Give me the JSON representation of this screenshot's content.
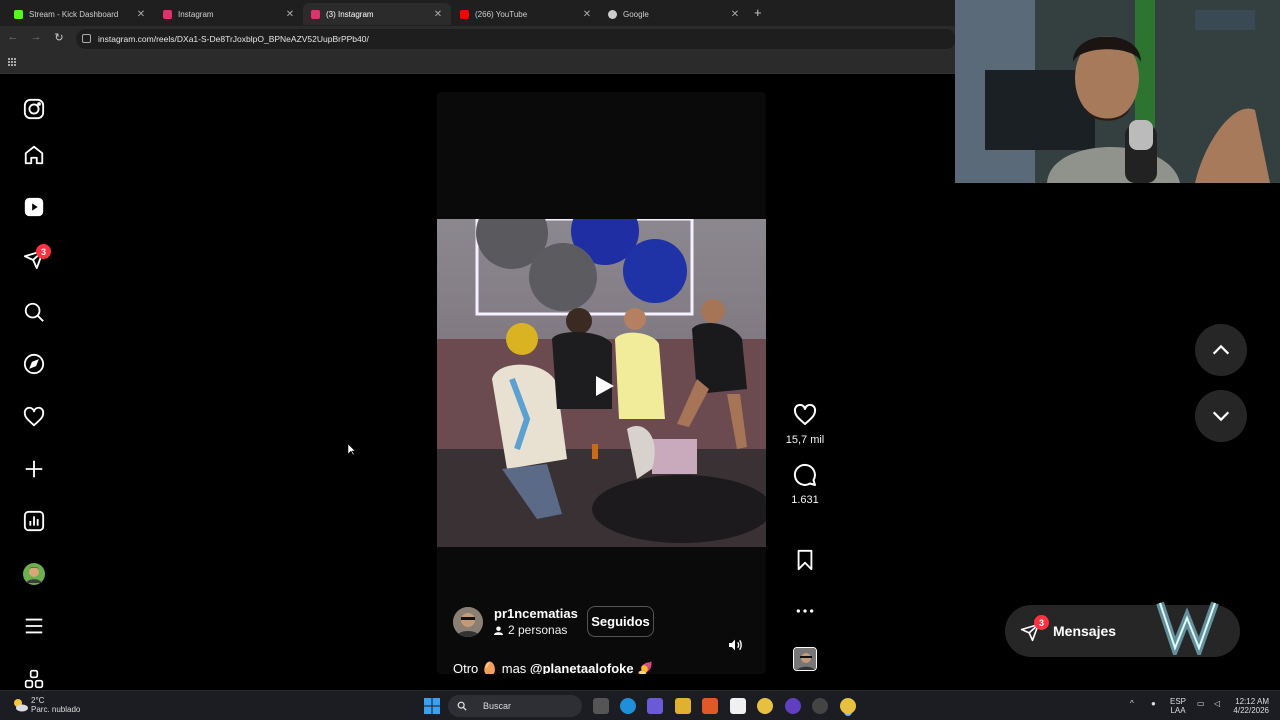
{
  "browser": {
    "tabs": [
      {
        "label": "Stream - Kick Dashboard",
        "color": "#53fc18",
        "active": false
      },
      {
        "label": "Instagram",
        "color": "#e1306c",
        "active": false
      },
      {
        "label": "(3) Instagram",
        "color": "#e1306c",
        "active": true
      },
      {
        "label": "(266) YouTube",
        "color": "#ff0000",
        "active": false
      },
      {
        "label": "Google",
        "color": "#cccccc",
        "active": false
      }
    ],
    "new_tab": "+",
    "url": "instagram.com/reels/DXa1-S-De8TrJoxblpO_BPNeAZV52UupBrPPb40/"
  },
  "sidebar": {
    "items": [
      {
        "icon": "instagram-icon"
      },
      {
        "icon": "home-icon"
      },
      {
        "icon": "reels-icon"
      },
      {
        "icon": "messages-icon",
        "badge": "3"
      },
      {
        "icon": "search-icon"
      },
      {
        "icon": "explore-icon"
      },
      {
        "icon": "notifications-icon"
      },
      {
        "icon": "create-icon"
      },
      {
        "icon": "dashboard-icon"
      },
      {
        "icon": "profile-avatar"
      },
      {
        "icon": "menu-icon"
      },
      {
        "icon": "also-from-meta-icon"
      }
    ]
  },
  "reel": {
    "username": "pr1ncematias",
    "followers_text": "2 personas",
    "follow_button": "Seguidos",
    "caption_pre": "Otro",
    "caption_mid": "mas",
    "caption_mention": "@planetaalofoke",
    "caption_emoji_1": "🥚",
    "caption_emoji_2": "🍠"
  },
  "actions": {
    "likes": "15,7 mil",
    "comments": "1.631"
  },
  "messages": {
    "label": "Mensajes",
    "badge": "3"
  },
  "taskbar": {
    "temp": "2°C",
    "weather": "Parc. nublado",
    "search": "Buscar",
    "lang_1": "ESP",
    "lang_2": "LAA",
    "time": "12:12 AM",
    "date": "4/22/2026"
  }
}
